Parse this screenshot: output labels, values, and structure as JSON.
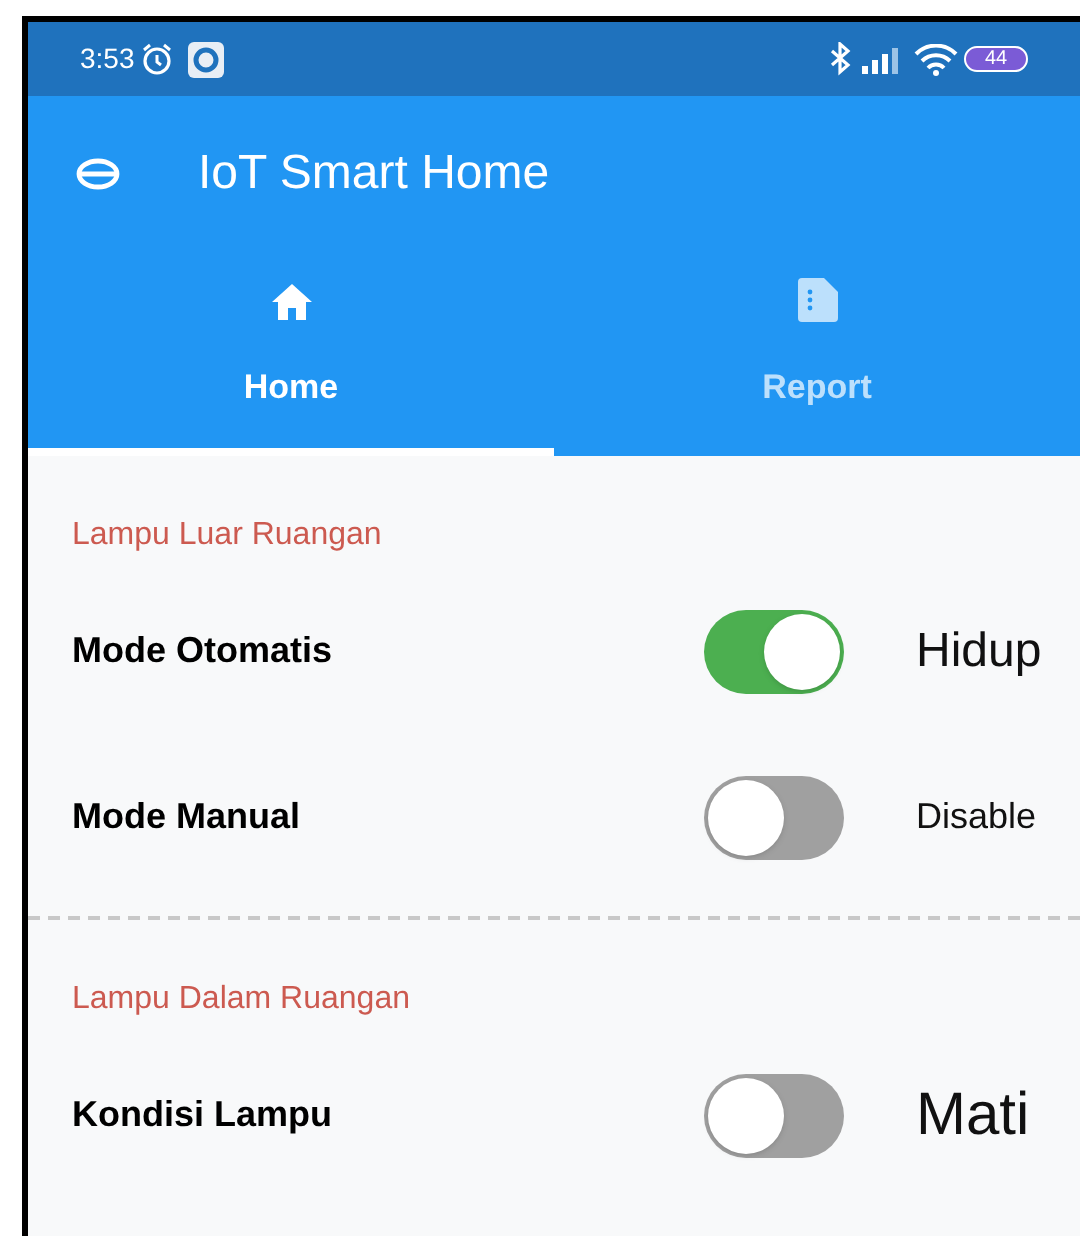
{
  "status_bar": {
    "time": "3:53",
    "battery": "44"
  },
  "app_bar": {
    "title": "IoT Smart Home"
  },
  "tabs": [
    {
      "label": "Home",
      "selected": true
    },
    {
      "label": "Report",
      "selected": false
    }
  ],
  "sections": [
    {
      "title": "Lampu Luar Ruangan",
      "rows": [
        {
          "label": "Mode Otomatis",
          "on": true,
          "reading": "Hidup"
        },
        {
          "label": "Mode Manual",
          "on": false,
          "reading": "Disable"
        }
      ]
    },
    {
      "title": "Lampu Dalam Ruangan",
      "rows": [
        {
          "label": "Kondisi Lampu",
          "on": false,
          "reading": "Mati"
        }
      ]
    }
  ]
}
